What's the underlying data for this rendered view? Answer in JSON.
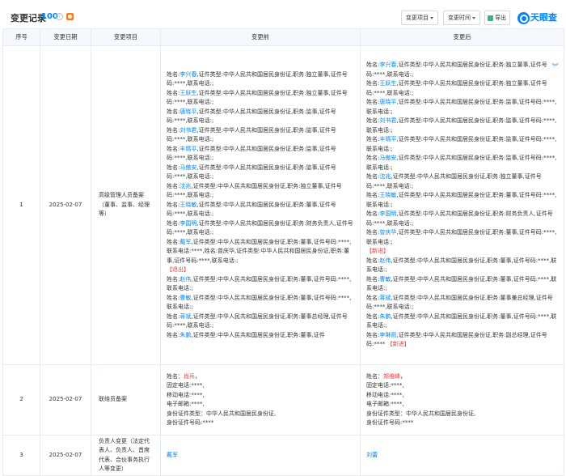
{
  "header": {
    "title": "变更记录",
    "count": "100",
    "filter_item": "变更项目",
    "filter_time": "变更时间",
    "export": "导出",
    "logo": "天眼查"
  },
  "columns": [
    "序号",
    "变更日期",
    "变更项目",
    "变更前",
    "变更后"
  ],
  "rows": [
    {
      "no": "1",
      "date": "2025-02-07",
      "item": "高级管理人员备案（董事、监事、经理等）",
      "before": [
        {
          "name": "李兴春",
          "text": ",证件类型:中华人民共和国居民身份证,职务:独立董事,证件号码:****,联系电话:;"
        },
        {
          "name": "王跃生",
          "text": ",证件类型:中华人民共和国居民身份证,职务:独立董事,证件号码:****,联系电话:;"
        },
        {
          "name": "唐晓平",
          "text": ",证件类型:中华人民共和国居民身份证,职务:监事,证件号码:****,联系电话:;"
        },
        {
          "name": "刘书君",
          "text": ",证件类型:中华人民共和国居民身份证,职务:监事,证件号码:****,联系电话:;"
        },
        {
          "name": "丰晴平",
          "text": ",证件类型:中华人民共和国居民身份证,职务:监事,证件号码:****,联系电话:;"
        },
        {
          "name": "马傲安",
          "text": ",证件类型:中华人民共和国居民身份证,职务:监事,证件号码:****,联系电话:;"
        },
        {
          "name": "沈兆",
          "text": ",证件类型:中华人民共和国居民身份证,职务:独立董事,证件号码:****,联系电话:;"
        },
        {
          "name": "王晓敏",
          "text": ",证件类型:中华人民共和国居民身份证,职务:董事,证件号码:****,联系电话:;"
        },
        {
          "name": "李国明",
          "text": ",证件类型:中华人民共和国居民身份证,职务:财务负责人,证件号码:****,联系电话:;"
        },
        {
          "name": "戴军",
          "text": ",证件类型:中华人民共和国居民身份证,职务:董事,证件号码:****,联系电话:****,姓名:曾庆华,证件类型:中华人民共和国居民身份证,职务:董事,证件号码:****,联系电话:;"
        },
        {
          "tag": "【退出】"
        },
        {
          "name": "赵伟",
          "text": ",证件类型:中华人民共和国居民身份证,职务:董事,证件号码:****,联系电话:;"
        },
        {
          "name": "曹敏",
          "text": ",证件类型:中华人民共和国居民身份证,职务:董事,证件号码:****,联系电话:;"
        },
        {
          "name": "蒋斌",
          "text": ",证件类型:中华人民共和国居民身份证,职务:董事总经理,证件号码:****,联系电话:;"
        },
        {
          "name": "朱鹏",
          "text": ",证件类型:中华人民共和国居民身份证,职务:董事,证件"
        }
      ],
      "after": [
        {
          "name": "李兴春",
          "text": ",证件类型:中华人民共和国居民身份证,职务:独立董事,证件号码:****,联系电话:;"
        },
        {
          "name": "王跃生",
          "text": ",证件类型:中华人民共和国居民身份证,职务:独立董事,证件号码:****,联系电话:;"
        },
        {
          "name": "唐晓平",
          "text": ",证件类型:中华人民共和国居民身份证,职务:监事,证件号码:****,联系电话:;"
        },
        {
          "name": "刘书君",
          "text": ",证件类型:中华人民共和国居民身份证,职务:监事,证件号码:****,联系电话:;"
        },
        {
          "name": "丰晴平",
          "text": ",证件类型:中华人民共和国居民身份证,职务:监事,证件号码:****,联系电话:;"
        },
        {
          "name": "马傲安",
          "text": ",证件类型:中华人民共和国居民身份证,职务:监事,证件号码:****,联系电话:;"
        },
        {
          "name": "沈兆",
          "text": ",证件类型:中华人民共和国居民身份证,职务:独立董事,证件号码:****,联系电话:;"
        },
        {
          "name": "王晓敏",
          "text": ",证件类型:中华人民共和国居民身份证,职务:董事,证件号码:****,联系电话:;"
        },
        {
          "name": "李国明",
          "text": ",证件类型:中华人民共和国居民身份证,职务:财务负责人,证件号码:****,联系电话:;"
        },
        {
          "name": "曾庆华",
          "text": ",证件类型:中华人民共和国居民身份证,职务:董事,证件号码:****,联系电话:;"
        },
        {
          "tag": "【新进】"
        },
        {
          "name": "赵伟",
          "text": ",证件类型:中华人民共和国居民身份证,职务:董事,证件号码:****,联系电话:;"
        },
        {
          "name": "曹敏",
          "text": ",证件类型:中华人民共和国居民身份证,职务:董事,证件号码:****,联系电话:;"
        },
        {
          "name": "蒋斌",
          "text": ",证件类型:中华人民共和国居民身份证,职务:董事兼总经理,证件号码:****,联系电话:;"
        },
        {
          "name": "朱鹏",
          "text": ",证件类型:中华人民共和国居民身份证,职务:董事,证件号码:****,联系电话:;"
        },
        {
          "name": "李琳雨",
          "text": ",证件类型:中华人民共和国居民身份证,职务:副总经理,证件号码:****",
          "tag2": "【新进】"
        }
      ]
    },
    {
      "no": "2",
      "date": "2025-02-07",
      "item": "联络员备案",
      "before_name": "肖兵",
      "before_lines": [
        "固定电话:****,",
        "移动电话:****,",
        "电子邮箱:****,",
        "身份证件类型：中华人民共和国居民身份证,",
        "身份证件号码:****"
      ],
      "after_name": "郑维峰",
      "after_lines": [
        "固定电话:****,",
        "移动电话:****,",
        "电子邮箱:****,",
        "身份证件类型：中华人民共和国居民身份证,",
        "身份证件号码:****"
      ],
      "name_prefix": "姓名：",
      "name_suffix": "，"
    },
    {
      "no": "3",
      "date": "2025-02-07",
      "item": "负责人变更（法定代表人、负责人、首席代表、合伙事务执行人等变更）",
      "before": "戴军",
      "after": "刘蕾"
    }
  ],
  "entry_prefix": "姓名:",
  "expand_icon": "chevron-double-down-icon"
}
